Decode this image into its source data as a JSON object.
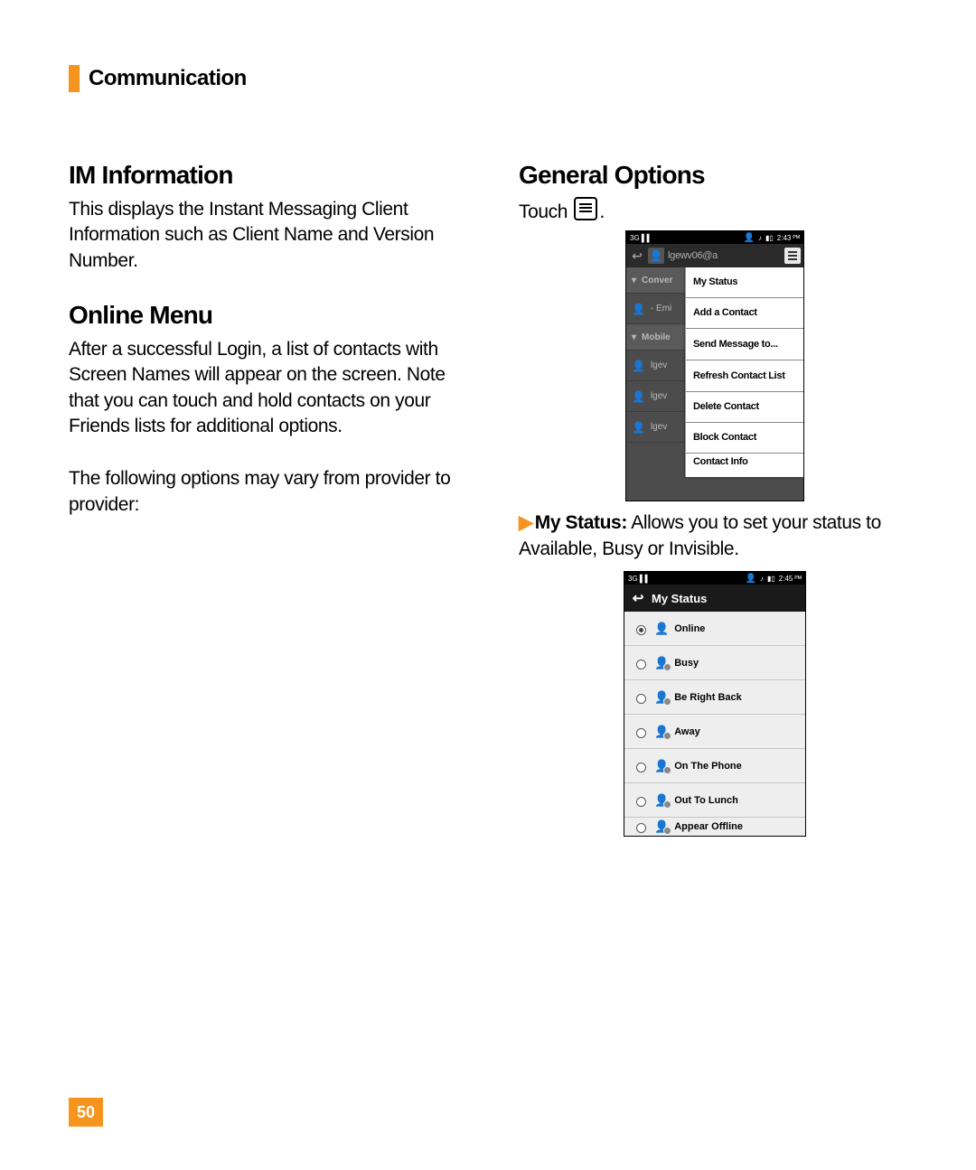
{
  "header": {
    "title": "Communication"
  },
  "page_number": "50",
  "left": {
    "h1": "IM Information",
    "p1": "This displays the Instant Messaging Client Information such as Client Name and Version Number.",
    "h2": "Online Menu",
    "p2": "After a successful Login, a list of contacts with Screen Names will appear on the screen. Note that you can touch and hold contacts on your Friends lists for additional options.",
    "p3": "The following options may vary from provider to provider:"
  },
  "right": {
    "h1": "General Options",
    "touch_prefix": "Touch ",
    "touch_suffix": ".",
    "bullet_label": "My Status:",
    "bullet_rest": " Allows you to set your status to Available, Busy or Invisible."
  },
  "shot1": {
    "status_left": "3G ▌▌",
    "status_time": "2:43 ᴾᴹ",
    "user": "lgewv06@a",
    "bg_rows": [
      {
        "type": "header",
        "label": "Conver"
      },
      {
        "type": "item",
        "label": "- Emi"
      },
      {
        "type": "header",
        "label": "Mobile"
      },
      {
        "type": "item",
        "label": "lgev"
      },
      {
        "type": "item",
        "label": "lgev"
      },
      {
        "type": "item",
        "label": "lgev"
      }
    ],
    "popup": [
      "My Status",
      "Add a Contact",
      "Send Message to...",
      "Refresh Contact List",
      "Delete Contact",
      "Block Contact",
      "Contact Info"
    ]
  },
  "shot2": {
    "status_left": "3G ▌▌",
    "status_time": "2:45 ᴾᴹ",
    "title": "My Status",
    "items": [
      {
        "label": "Online",
        "selected": true
      },
      {
        "label": "Busy",
        "selected": false
      },
      {
        "label": "Be Right Back",
        "selected": false
      },
      {
        "label": "Away",
        "selected": false
      },
      {
        "label": "On The Phone",
        "selected": false
      },
      {
        "label": "Out To Lunch",
        "selected": false
      },
      {
        "label": "Appear Offline",
        "selected": false,
        "cut": true
      }
    ]
  }
}
